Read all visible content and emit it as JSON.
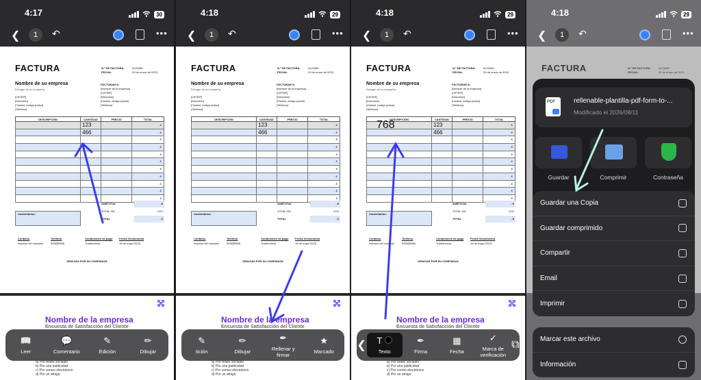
{
  "panels": [
    {
      "time": "4:17",
      "battery": "30",
      "page": "1",
      "invoice": {
        "title": "FACTURA",
        "num_label": "N.º DE FACTURA:",
        "num_value": "#123456",
        "date_label": "FECHA:",
        "date_value": "20 de enero de 2023",
        "company": "Nombre de su empresa",
        "company_sub": "Eslogan de la compañía",
        "addr": [
          "[CIF/NIF]",
          "[Dirección]",
          "[Ciudad, código postal]",
          "[Teléfono]"
        ],
        "bill_label": "FACTURAR A:",
        "bill": [
          "[Nombre de la empresa]",
          "[CIF/NIF]",
          "[Dirección]",
          "[Ciudad, código postal]",
          "[Teléfono]"
        ],
        "headers": [
          "DESCRIPCIÓN",
          "CANTIDAD",
          "PRECIO",
          "TOTAL"
        ],
        "qty": [
          "123",
          "466"
        ],
        "desc_big": "",
        "currency": "- €",
        "subtotal": "SUBTOTAL",
        "tax_label": "TOTAL IVA",
        "tax_pct": "21%",
        "total": "TOTAL",
        "comments": "Comentarios:",
        "contact_headers": [
          "Contacto",
          "Teléfono",
          "Condiciones de pago",
          "Fecha Vencimiento"
        ],
        "contact_values": [
          "Nombre del contacto",
          "949555555",
          "Tranferencia",
          "15 de mayo 2023"
        ],
        "thanks": "GRACIAS POR SU CONFIANZA"
      },
      "toolbar": [
        {
          "icon": "book-icon",
          "label": "Leer"
        },
        {
          "icon": "comment-icon",
          "label": "Comentario"
        },
        {
          "icon": "edit-text-icon",
          "label": "Edición"
        },
        {
          "icon": "pen-icon",
          "label": "Dibujar"
        }
      ]
    },
    {
      "time": "4:18",
      "battery": "29",
      "page": "1",
      "qty": [
        "123",
        "466"
      ],
      "desc_big": "",
      "toolbar": [
        {
          "icon": "edit-text-icon",
          "label": "tición"
        },
        {
          "icon": "pen-icon",
          "label": "Dibujar"
        },
        {
          "icon": "signature-icon",
          "label": "Rellenar y firmar"
        },
        {
          "icon": "stamp-icon",
          "label": "Marcado"
        }
      ]
    },
    {
      "time": "4:18",
      "battery": "29",
      "page": "1",
      "qty": [
        "123",
        "466"
      ],
      "desc_big": "768",
      "toolbar": [
        {
          "icon": "text-icon",
          "label": "Texto"
        },
        {
          "icon": "signature-icon",
          "label": "Firma"
        },
        {
          "icon": "calendar-icon",
          "label": "Fecha"
        },
        {
          "icon": "checkmark-icon",
          "label": "Marca de verificación"
        }
      ]
    },
    {
      "time": "4:18",
      "battery": "29",
      "page": "1"
    }
  ],
  "second_page": {
    "company": "Nombre de la empresa",
    "subtitle": "Encuesta de Satisfacción del Cliente",
    "options": [
      "a)  Por redes sociales",
      "b)  Por una publicidad",
      "c)  Por correo electrónico",
      "d)  Por un amigo"
    ]
  },
  "share_sheet": {
    "file_name": "rellenable-plantilla-pdf-form-to-...",
    "modified": "Modificado el 2026/08/11",
    "actions": [
      {
        "icon": "folder-icon",
        "label": "Guardar"
      },
      {
        "icon": "printer-icon",
        "label": "Comprimir"
      },
      {
        "icon": "shield-icon",
        "label": "Contraseña"
      }
    ],
    "menu": [
      {
        "label": "Guardar una Copia",
        "icon": "copy-icon"
      },
      {
        "label": "Guardar comprimido",
        "icon": "compress-icon"
      },
      {
        "label": "Compartir",
        "icon": "share-icon"
      },
      {
        "label": "Email",
        "icon": "mail-icon"
      },
      {
        "label": "Imprimir",
        "icon": "print-icon"
      }
    ],
    "menu2": [
      {
        "label": "Marcar este archivo",
        "icon": "star-icon"
      },
      {
        "label": "Información",
        "icon": "info-icon"
      }
    ]
  },
  "colors": {
    "accent": "#3b3bf0",
    "arrow_light": "#b8f0e6",
    "brand_purple": "#6a2bd9"
  }
}
